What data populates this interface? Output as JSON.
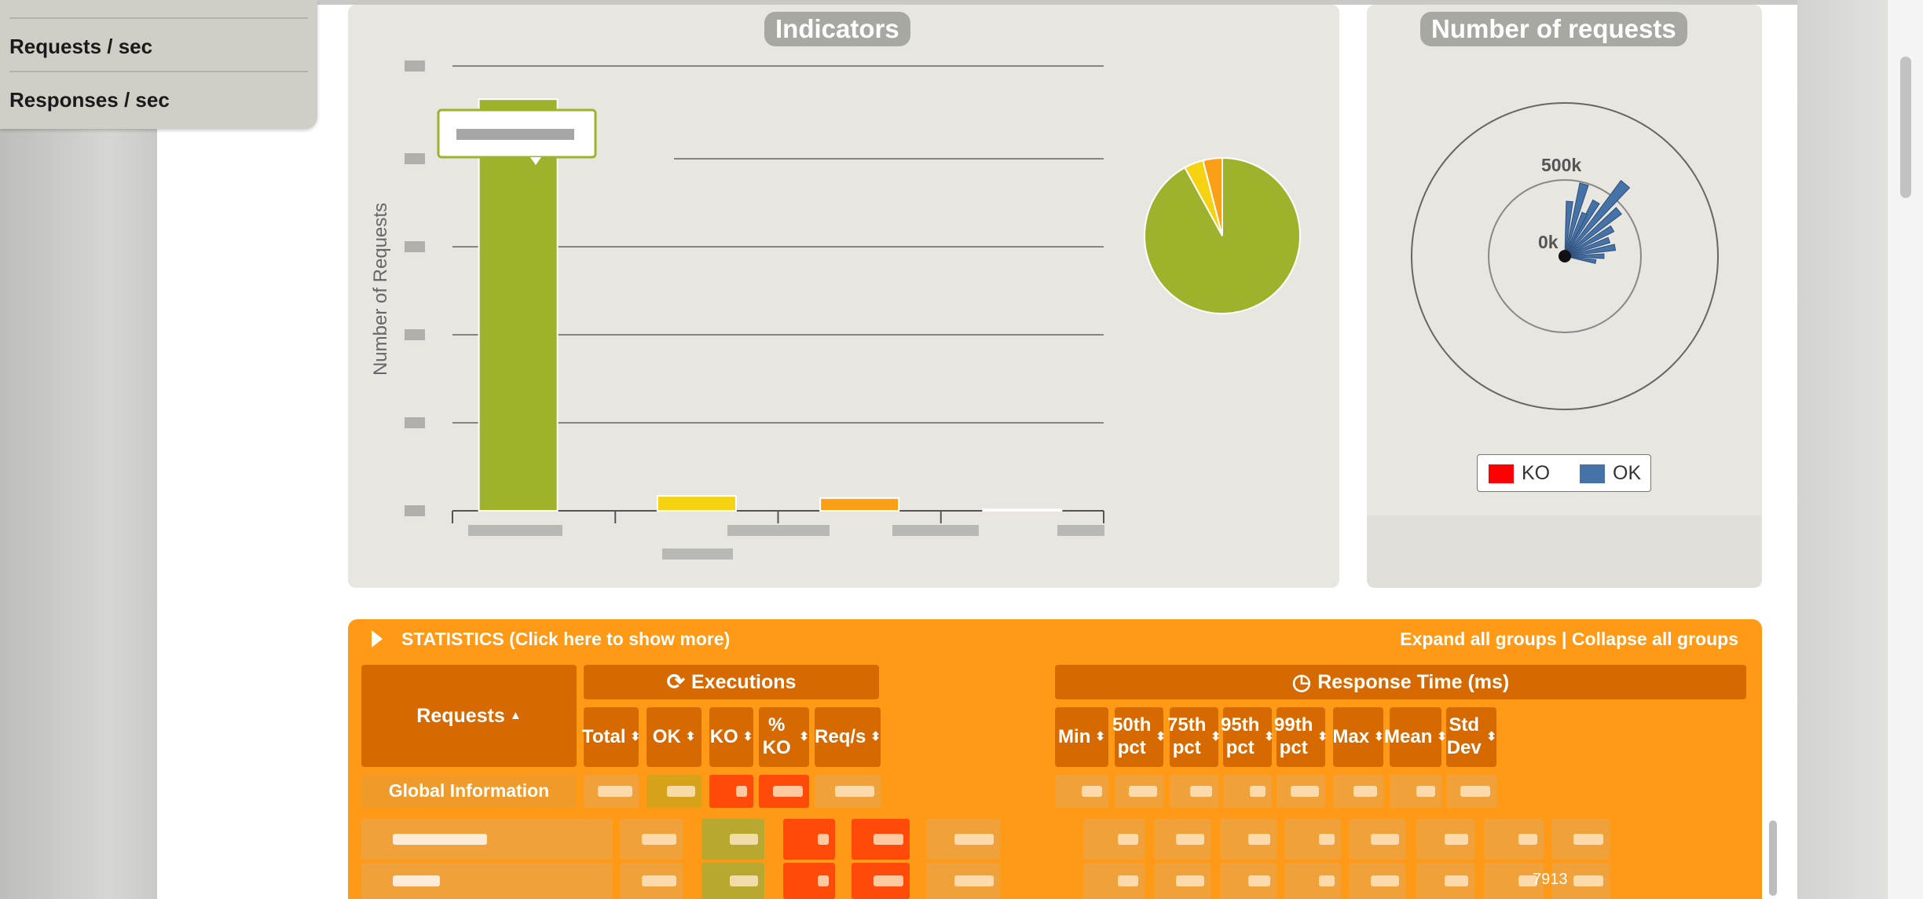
{
  "menu": {
    "items": [
      "Requests / sec",
      "Responses / sec"
    ]
  },
  "indicators": {
    "title": "Indicators",
    "y_axis_label": "Number of Requests",
    "colors": {
      "ok_fast": "#9fb22c",
      "ok_medium": "#f5d312",
      "ok_slow": "#fb9f17",
      "failed": "#ec4c1c"
    },
    "chart_data": {
      "type": "bar",
      "values": [
        97,
        3.5,
        3,
        0.3
      ]
    },
    "pie_data": {
      "type": "pie",
      "values": [
        92,
        4,
        4
      ]
    }
  },
  "requests_panel": {
    "title": "Number of requests",
    "chart_data": {
      "type": "pie",
      "rings": [
        "500k",
        "0k"
      ]
    },
    "legend": [
      {
        "label": "KO",
        "color": "#ff0000"
      },
      {
        "label": "OK",
        "color": "#4572a7"
      }
    ]
  },
  "statistics": {
    "title": "STATISTICS (Click here to show more)",
    "expand_all": "Expand all groups",
    "separator": "|",
    "collapse_all": "Collapse all groups",
    "groups": {
      "executions": "Executions",
      "response_time": "Response Time (ms)"
    },
    "columns": {
      "requests": "Requests",
      "total": "Total",
      "ok": "OK",
      "ko": "KO",
      "pct_ko": "% KO",
      "req_s": "Req/s",
      "min": "Min",
      "p50": "50th pct",
      "p75": "75th pct",
      "p95": "95th pct",
      "p99": "99th pct",
      "max": "Max",
      "mean": "Mean",
      "std_dev": "Std Dev"
    },
    "global_row_label": "Global Information",
    "visible_value": "7913"
  }
}
